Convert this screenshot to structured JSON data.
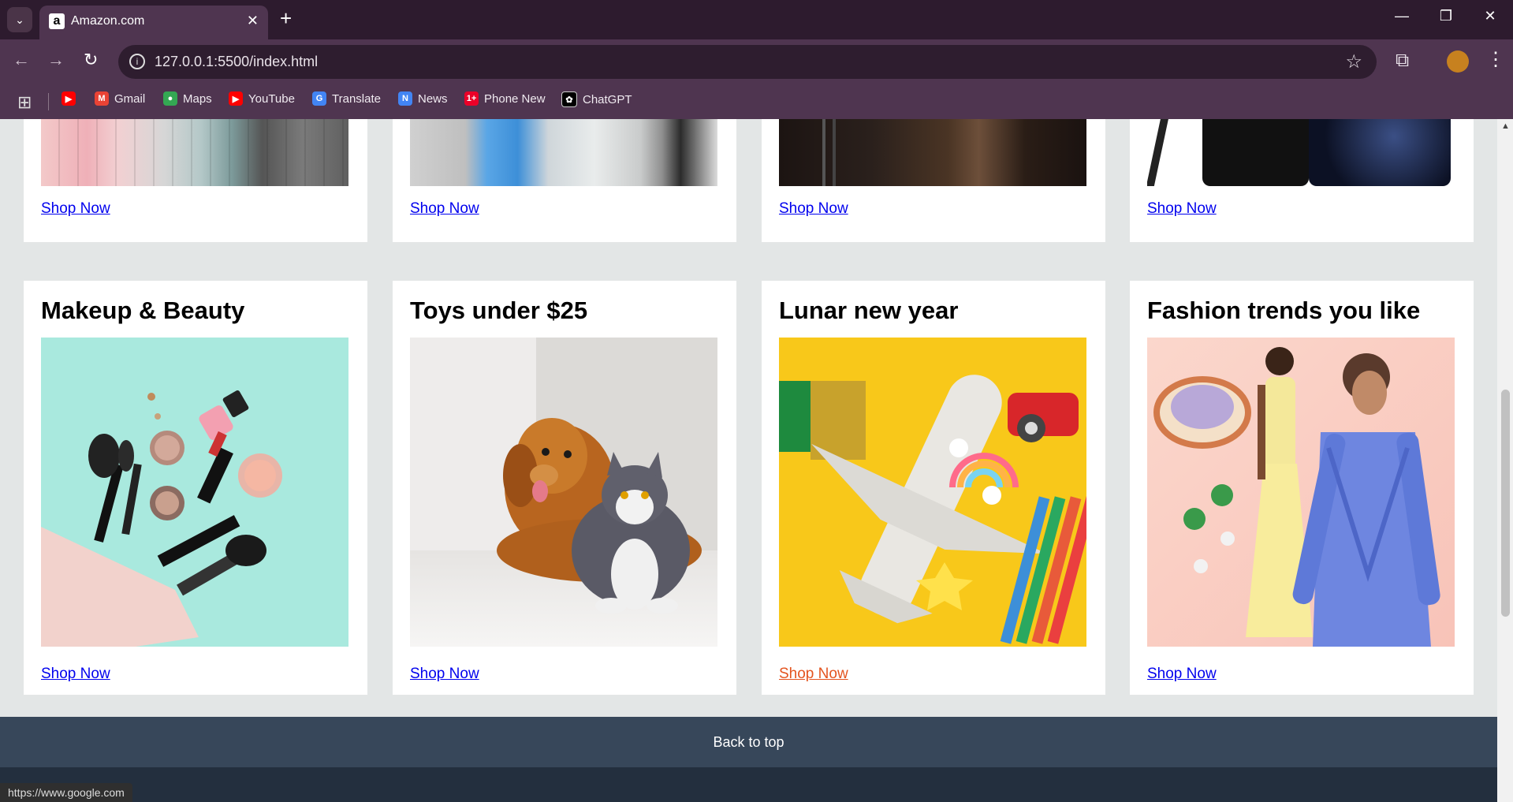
{
  "browser": {
    "tab_title": "Amazon.com",
    "url": "127.0.0.1:5500/index.html",
    "status_url": "https://www.google.com"
  },
  "bookmarks": [
    {
      "label": "",
      "icon": "youtube-icon",
      "color": "#ff0000"
    },
    {
      "label": "Gmail",
      "icon": "gmail-icon",
      "color": "#ea4335"
    },
    {
      "label": "Maps",
      "icon": "maps-icon",
      "color": "#34a853"
    },
    {
      "label": "YouTube",
      "icon": "youtube-icon",
      "color": "#ff0000"
    },
    {
      "label": "Translate",
      "icon": "translate-icon",
      "color": "#4285f4"
    },
    {
      "label": "News",
      "icon": "news-icon",
      "color": "#4285f4"
    },
    {
      "label": "Phone New",
      "icon": "oneplus-icon",
      "color": "#eb0028"
    },
    {
      "label": "ChatGPT",
      "icon": "chatgpt-icon",
      "color": "#000000"
    }
  ],
  "top_cards": [
    {
      "link": "Shop Now"
    },
    {
      "link": "Shop Now"
    },
    {
      "link": "Shop Now"
    },
    {
      "link": "Shop Now"
    }
  ],
  "cards": [
    {
      "title": "Makeup & Beauty",
      "link": "Shop Now"
    },
    {
      "title": "Toys under $25",
      "link": "Shop Now"
    },
    {
      "title": "Lunar new year",
      "link": "Shop Now"
    },
    {
      "title": "Fashion trends you like",
      "link": "Shop Now"
    }
  ],
  "footer": {
    "back_to_top": "Back to top"
  }
}
